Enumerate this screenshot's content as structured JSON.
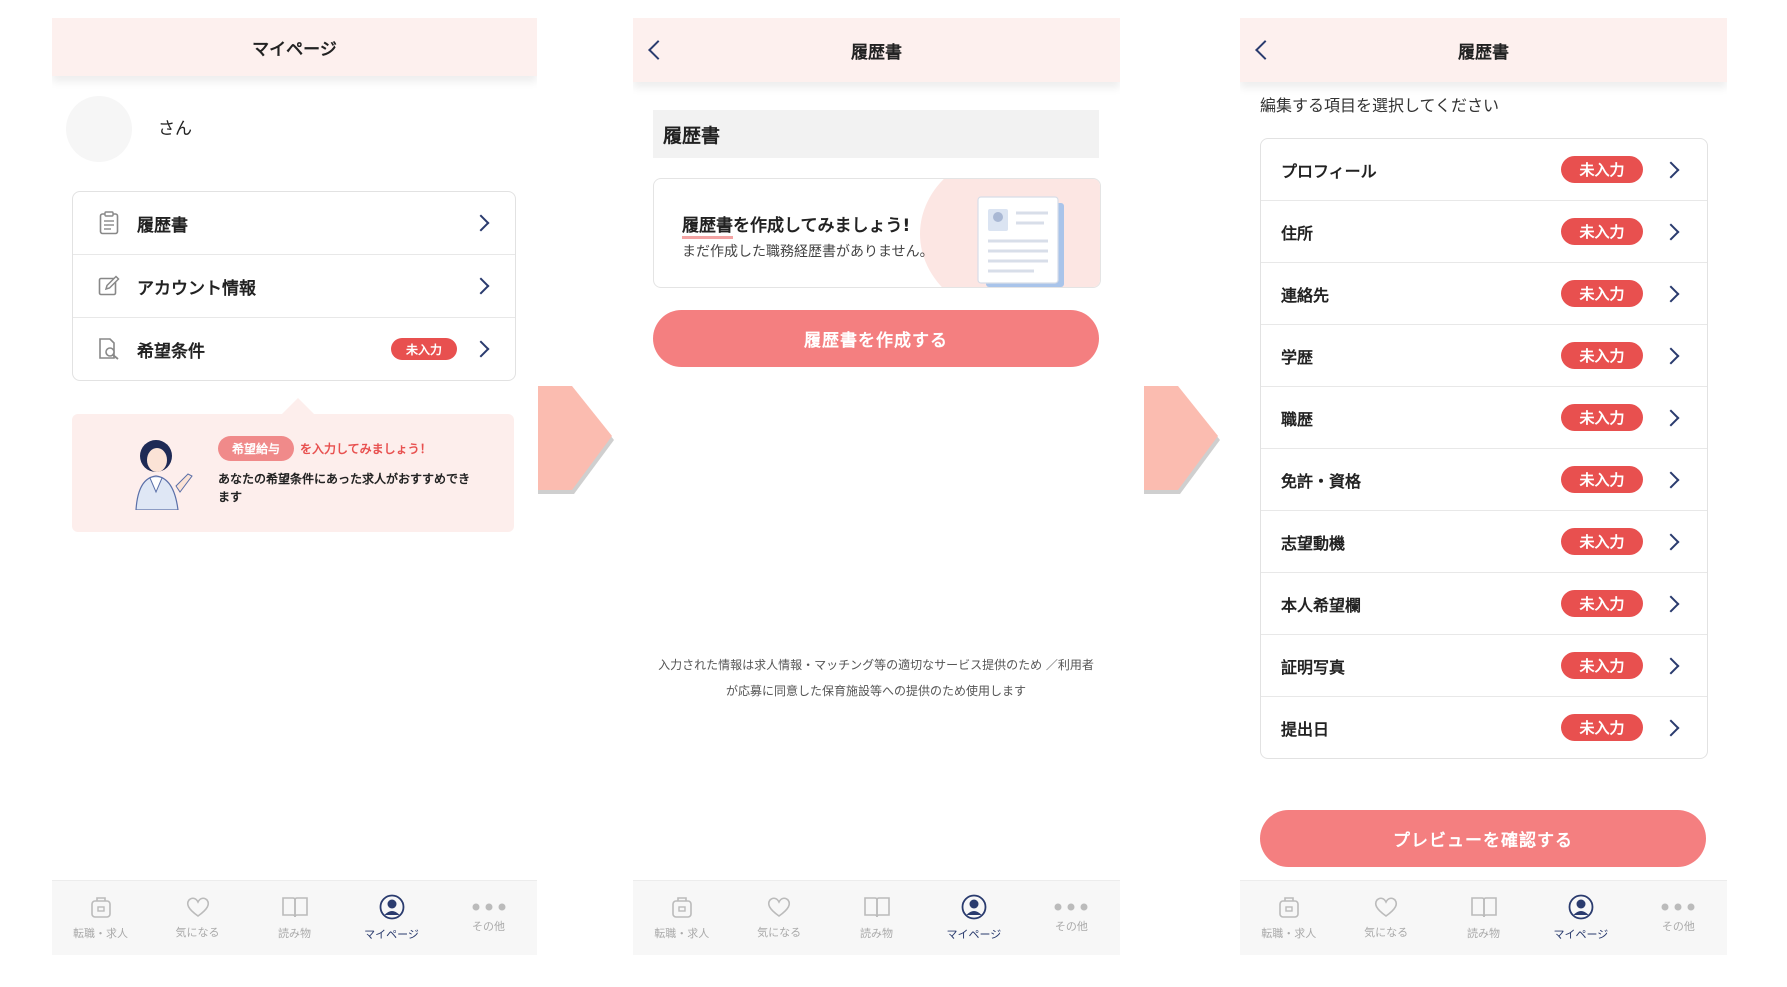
{
  "screen1": {
    "header_title": "マイページ",
    "user_name": "さん",
    "menu": [
      {
        "label": "履歴書",
        "icon": "document-icon",
        "badge": ""
      },
      {
        "label": "アカウント情報",
        "icon": "edit-icon",
        "badge": ""
      },
      {
        "label": "希望条件",
        "icon": "search-document-icon",
        "badge": "未入力"
      }
    ],
    "tip": {
      "pill": "希望給与",
      "after_pill": "を入力してみましょう！",
      "body": "あなたの希望条件にあった求人がおすすめできます"
    }
  },
  "screen2": {
    "header_title": "履歴書",
    "section_title": "履歴書",
    "card_title_underlined": "履歴書",
    "card_title_rest": "を作成してみましょう!",
    "card_subtitle": "まだ作成した職務経歴書がありません。",
    "create_button": "履歴書を作成する",
    "notice_line1": "入力された情報は求人情報・マッチング等の適切なサービス提供のため ／利用者",
    "notice_line2": "が応募に同意した保育施設等への提供のため使用します"
  },
  "screen3": {
    "header_title": "履歴書",
    "instruction": "編集する項目を選択してください",
    "items": [
      {
        "label": "プロフィール",
        "badge": "未入力"
      },
      {
        "label": "住所",
        "badge": "未入力"
      },
      {
        "label": "連絡先",
        "badge": "未入力"
      },
      {
        "label": "学歴",
        "badge": "未入力"
      },
      {
        "label": "職歴",
        "badge": "未入力"
      },
      {
        "label": "免許・資格",
        "badge": "未入力"
      },
      {
        "label": "志望動機",
        "badge": "未入力"
      },
      {
        "label": "本人希望欄",
        "badge": "未入力"
      },
      {
        "label": "証明写真",
        "badge": "未入力"
      },
      {
        "label": "提出日",
        "badge": "未入力"
      }
    ],
    "preview_button": "プレビューを確認する"
  },
  "tabs": [
    {
      "label": "転職・求人",
      "icon": "bag-icon"
    },
    {
      "label": "気になる",
      "icon": "heart-icon"
    },
    {
      "label": "読み物",
      "icon": "book-icon"
    },
    {
      "label": "マイページ",
      "icon": "user-icon",
      "active": true
    },
    {
      "label": "その他",
      "icon": "more-icon"
    }
  ],
  "colors": {
    "header_bg": "#fdf0ee",
    "accent": "#f47f80",
    "badge": "#e8504f",
    "nav_active": "#2a3b6e",
    "flow_arrow": "#fbbcb0"
  }
}
